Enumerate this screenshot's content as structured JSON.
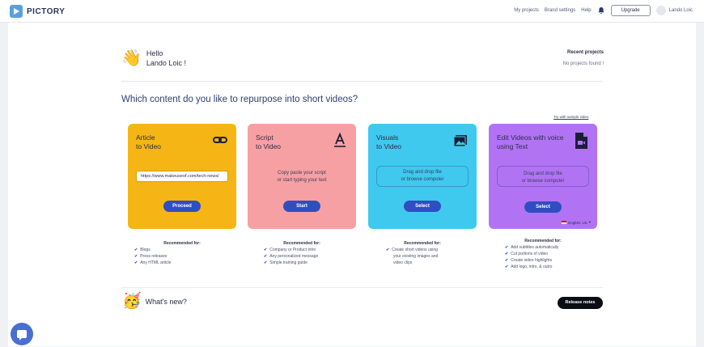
{
  "app": {
    "name": "PICTORY"
  },
  "nav": {
    "my_projects": "My projects",
    "brand_settings": "Brand settings",
    "help": "Help",
    "upgrade": "Upgrade",
    "user_name": "Lando Loic"
  },
  "greeting": {
    "hello": "Hello",
    "name": "Lando Loic !"
  },
  "recent_projects": {
    "title": "Recent projects",
    "empty": "No projects found !"
  },
  "heading": "Which content do you like to repurpose into short videos?",
  "sample_link": "Try with sample video",
  "cards": [
    {
      "title_line1": "Article",
      "title_line2": "to Video",
      "input_value": "https://www.makeuseof.com/tech-news/",
      "button": "Proceed",
      "recommended_title": "Recommended for:",
      "recommended": [
        "Blogs",
        "Press releases",
        "Any HTML article"
      ],
      "color": "#f5b514"
    },
    {
      "title_line1": "Script",
      "title_line2": "to Video",
      "body_line1": "Copy paste your script",
      "body_line2": "or start typing your text",
      "button": "Start",
      "recommended_title": "Recommended for:",
      "recommended": [
        "Company or Product intro",
        "Any personalized message",
        "Simple training guide"
      ],
      "color": "#f7a0a4"
    },
    {
      "title_line1": "Visuals",
      "title_line2": "to Video",
      "body_line1": "Drag and drop file",
      "body_line2": "or browse computer",
      "button": "Select",
      "recommended_title": "Recommended for:",
      "recommended": [
        "Create short videos using",
        "your existing images and",
        "video clips"
      ],
      "color": "#3fc9ef"
    },
    {
      "title_line1": "Edit Videos with voice",
      "title_line2": "using Text",
      "body_line1": "Drag and drop file",
      "body_line2": "or browse computer",
      "button": "Select",
      "language": "English, US",
      "recommended_title": "Recommended for:",
      "recommended": [
        "Add subtitles automatically",
        "Cut portions of video",
        "Create video highlights",
        "Add logo, intro, & outro"
      ],
      "color": "#b173f4"
    }
  ],
  "whats_new": {
    "title": "What's new?",
    "button": "Release notes"
  },
  "icons": {
    "logo": "pictory-logo-icon",
    "bell": "bell-icon",
    "card1": "link-icon",
    "card2": "text-a-icon",
    "card3": "image-folder-icon",
    "card4": "video-file-icon",
    "chat": "chat-icon"
  }
}
